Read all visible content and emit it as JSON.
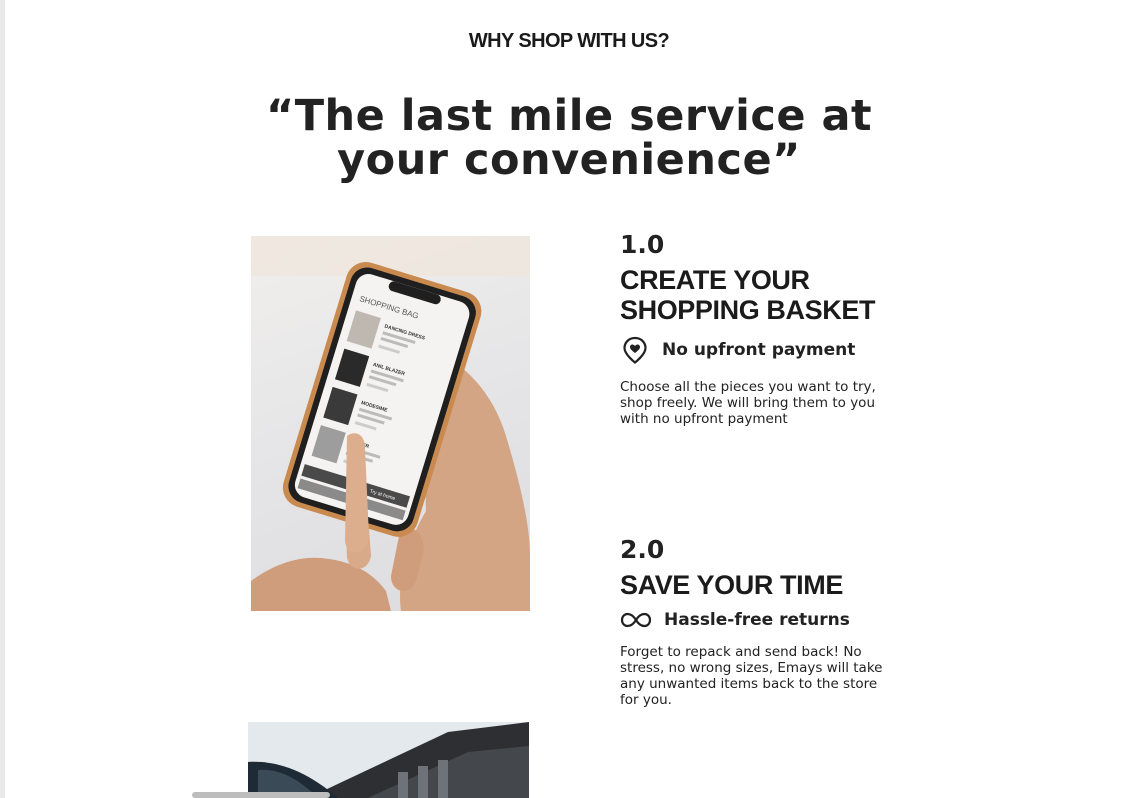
{
  "section": {
    "eyebrow": "WHY SHOP WITH US?",
    "headline_line1": "“The last mile service at",
    "headline_line2": "your convenience”"
  },
  "steps": [
    {
      "number": "1.0",
      "title_line1": "CREATE YOUR",
      "title_line2": "SHOPPING BASKET",
      "feature_icon": "location-heart-icon",
      "feature_label": "No upfront payment",
      "description": "Choose all the pieces you want to try, shop freely. We will bring them to you with no upfront payment"
    },
    {
      "number": "2.0",
      "title_line1": "SAVE YOUR TIME",
      "feature_icon": "infinity-icon",
      "feature_label": "Hassle-free returns",
      "description": "Forget to repack and send back! No stress, no wrong sizes, Emays will take any unwanted items back to the store for you."
    }
  ],
  "phone_screen": {
    "header": "SHOPPING BAG",
    "items": [
      "DANCING DRESS",
      "ANIL BLAZER",
      "MODESIME",
      "BLAZER"
    ],
    "try_at_home": "Try at home"
  }
}
